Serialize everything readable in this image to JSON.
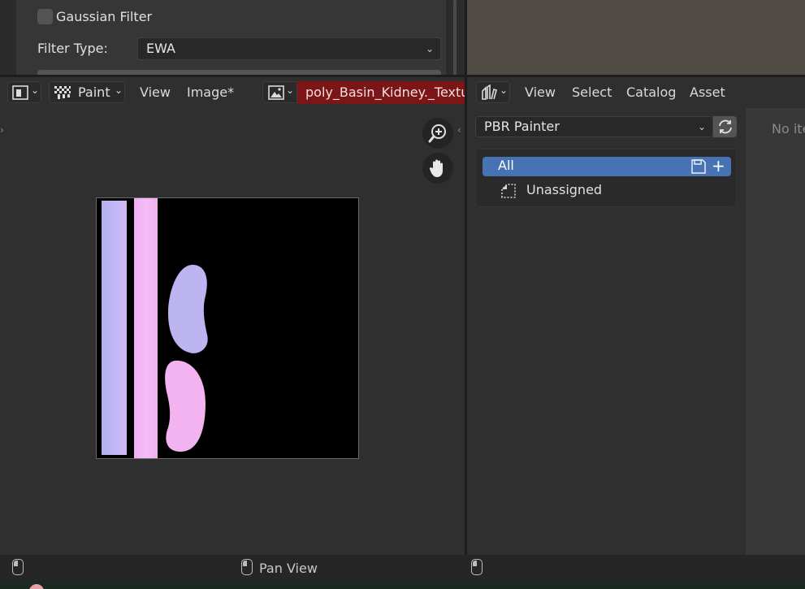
{
  "properties": {
    "gaussian_label": "Gaussian Filter",
    "gaussian_checked": false,
    "filter_type_label": "Filter Type:",
    "filter_type_value": "EWA"
  },
  "image_editor": {
    "editor_type_icon": "image-editor-icon",
    "mode_label": "Paint",
    "menus": [
      "View",
      "Image*"
    ],
    "image_name": "poly_Basin_Kidney._Textur",
    "zoom_icon": "zoom-in-icon",
    "pan_icon": "hand-icon"
  },
  "asset_browser": {
    "menus": [
      "View",
      "Select",
      "Catalog",
      "Asset"
    ],
    "library_value": "PBR Painter",
    "refresh_icon": "refresh-icon",
    "catalogs": [
      {
        "label": "All",
        "selected": true
      },
      {
        "label": "Unassigned",
        "selected": false
      }
    ],
    "empty_text": "No ite"
  },
  "status_bar": {
    "center_label": "Pan View"
  },
  "colors": {
    "selection": "#4772b3",
    "image_name_bg": "#7c1515",
    "texture_lavender": "#b3b3f5",
    "texture_pink": "#f5b3f5"
  }
}
